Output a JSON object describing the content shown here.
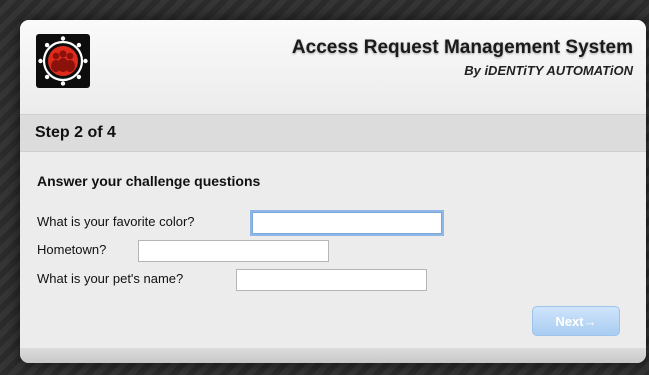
{
  "header": {
    "title": "Access Request Management System",
    "subtitle": "By iDENTiTY AUTOMATiON",
    "logo_icon": "people-group-logo-icon",
    "logo_color": "#e02a1c"
  },
  "step": {
    "label": "Step 2 of 4"
  },
  "form": {
    "title": "Answer your challenge questions",
    "questions": [
      {
        "label": "What is your favorite color?",
        "value": ""
      },
      {
        "label": "Hometown?",
        "value": ""
      },
      {
        "label": "What is your pet's name?",
        "value": ""
      }
    ],
    "next_label": "Next→",
    "next_color": "#a9cdf2"
  }
}
